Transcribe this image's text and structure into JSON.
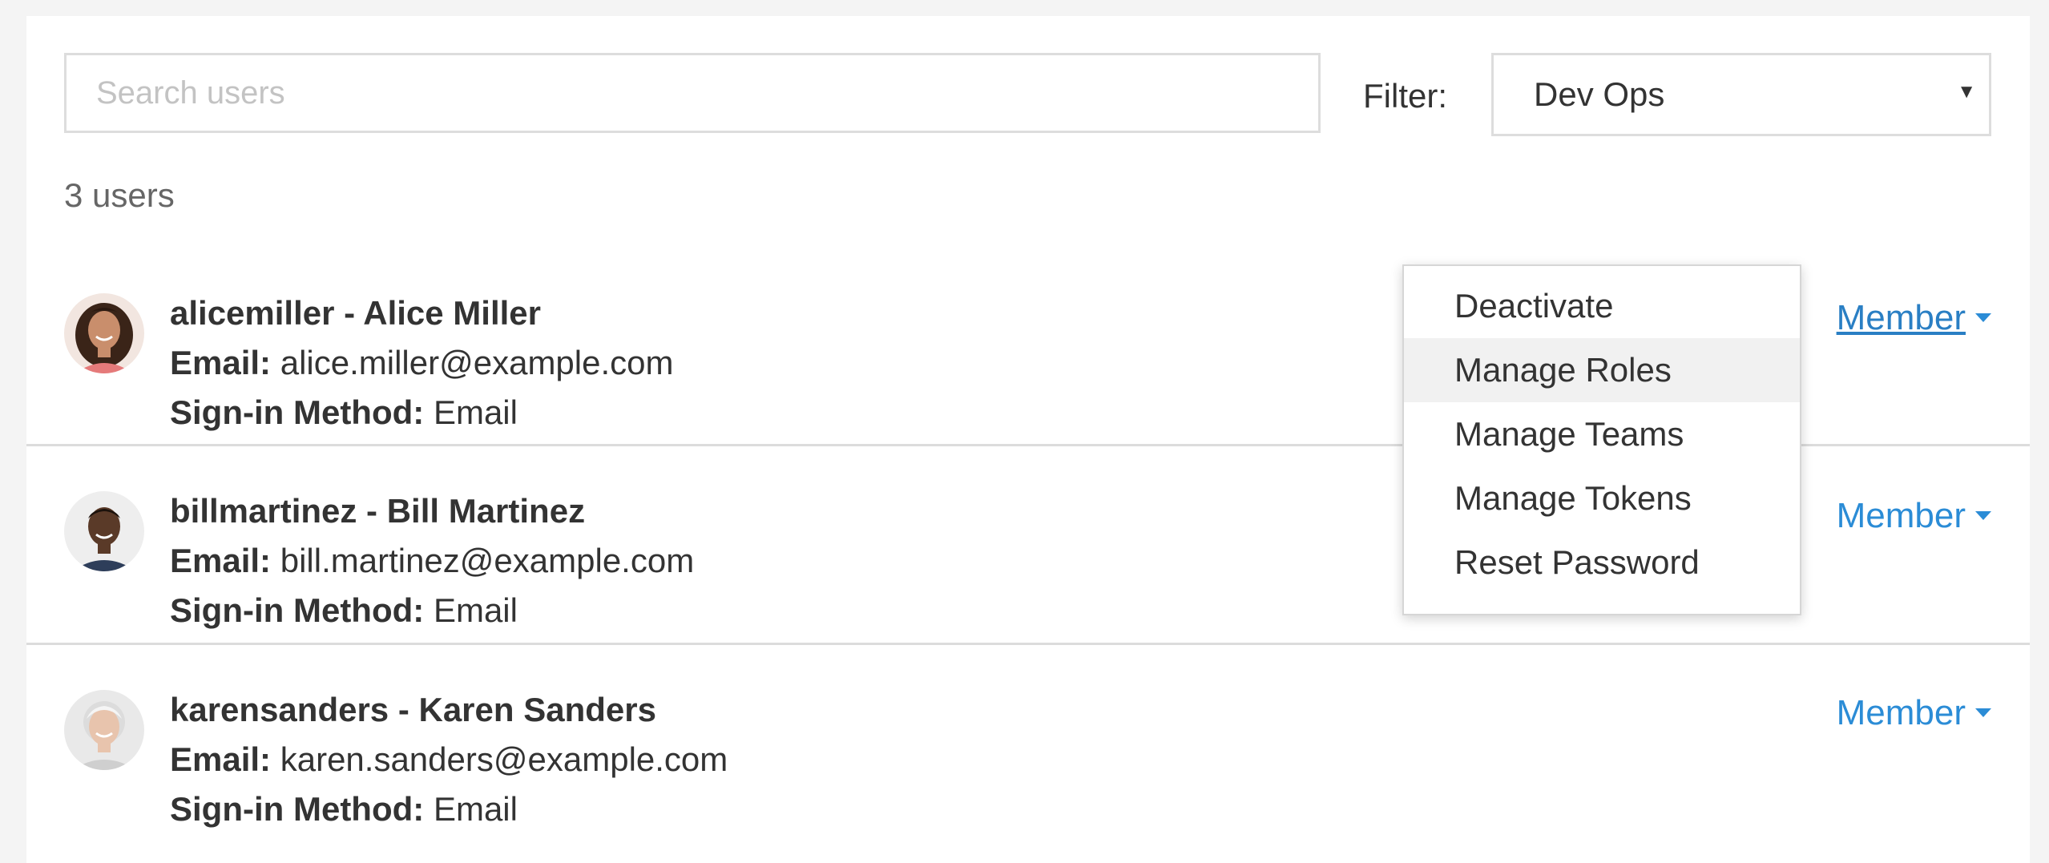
{
  "search": {
    "placeholder": "Search users",
    "value": ""
  },
  "filter": {
    "label": "Filter:",
    "selected": "Dev Ops"
  },
  "user_count": "3 users",
  "field_labels": {
    "email": "Email:",
    "signin": "Sign-in Method:"
  },
  "users": [
    {
      "heading": "alicemiller - Alice Miller",
      "email": "alice.miller@example.com",
      "signin": "Email",
      "role": "Member"
    },
    {
      "heading": "billmartinez - Bill Martinez",
      "email": "bill.martinez@example.com",
      "signin": "Email",
      "role": "Member"
    },
    {
      "heading": "karensanders - Karen Sanders",
      "email": "karen.sanders@example.com",
      "signin": "Email",
      "role": "Member"
    }
  ],
  "menu": {
    "items": [
      "Deactivate",
      "Manage Roles",
      "Manage Teams",
      "Manage Tokens",
      "Reset Password"
    ],
    "highlighted": "Manage Roles"
  },
  "colors": {
    "link": "#2b8cd6",
    "text": "#333333",
    "muted": "#666666",
    "border": "#dddddd",
    "page_background": "#f4f4f4"
  },
  "icons": {
    "filter_caret": "caret-down-icon",
    "role_caret": "caret-down-icon"
  }
}
